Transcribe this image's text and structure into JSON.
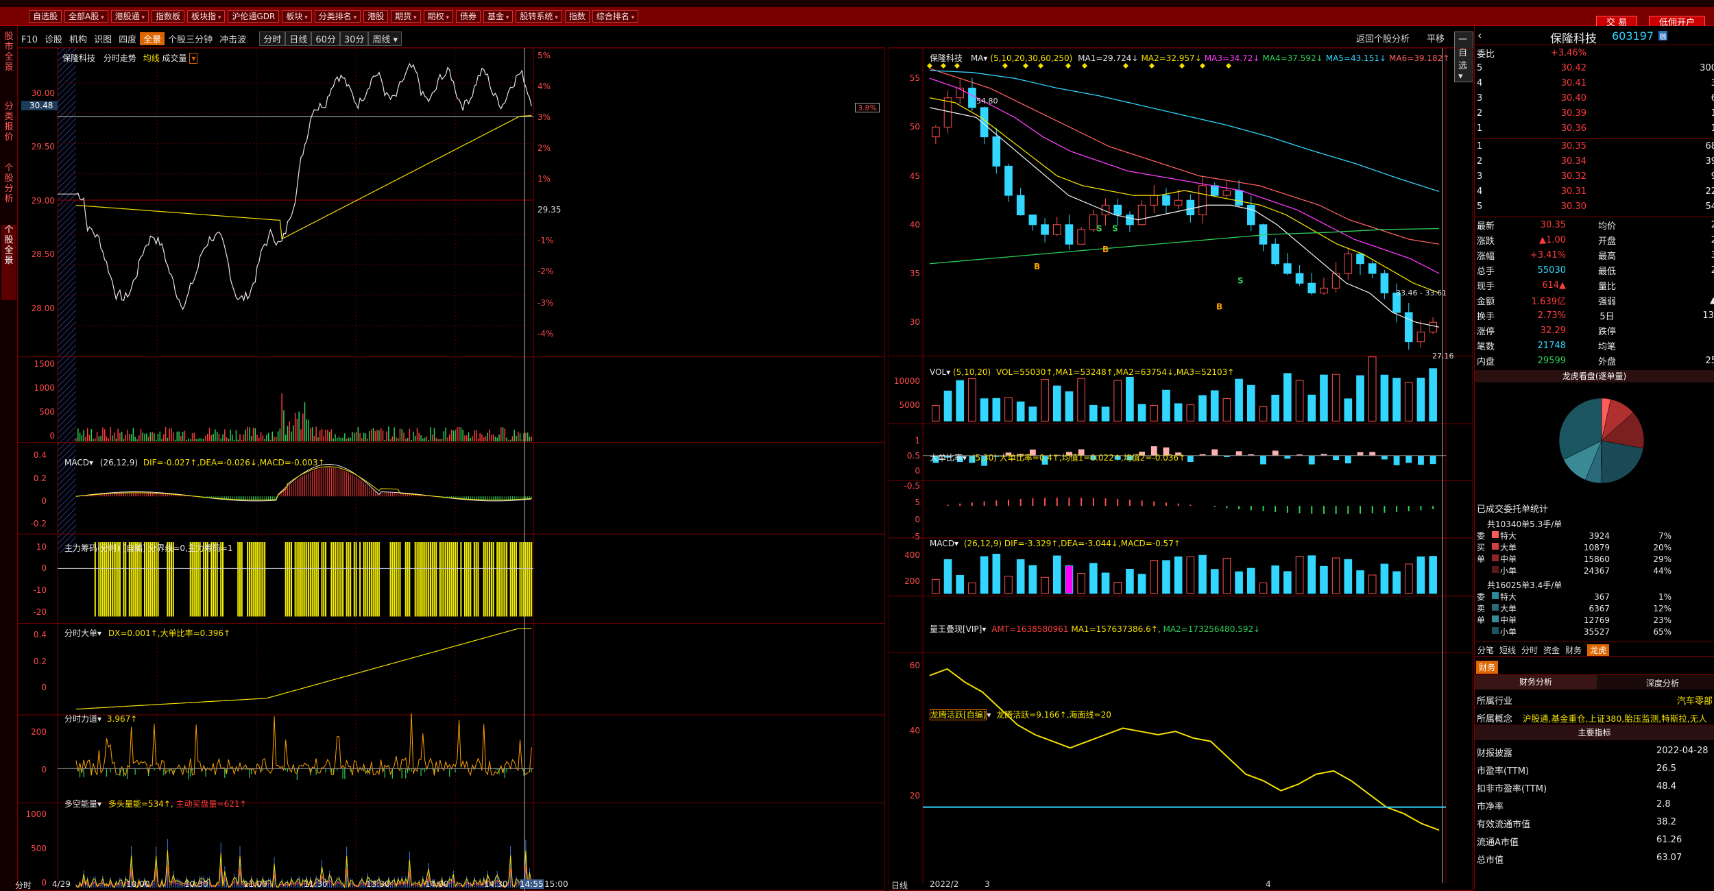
{
  "menu": {
    "items": [
      "自选股",
      "全部A股",
      "港股通",
      "指数板",
      "板块指",
      "沪伦通GDR",
      "板块",
      "分类排名",
      "港股",
      "期货",
      "期权",
      "债券",
      "基金",
      "股转系统",
      "指数",
      "综合排名"
    ],
    "trade_btn": "交 易",
    "account_btn": "低佣开户"
  },
  "left_tabs": [
    "股市全景",
    "分类报价",
    "个股分析",
    "个股全景"
  ],
  "toolbar": {
    "items": [
      "F10",
      "诊股",
      "机构",
      "识图",
      "四度",
      "全景",
      "个股三分钟",
      "冲击波"
    ],
    "periods": [
      "分时",
      "日线",
      "60分",
      "30分",
      "周线"
    ]
  },
  "right_toolbar": {
    "back": "返回个股分析",
    "flat": "平移",
    "mode": "一自选"
  },
  "intraday": {
    "header": {
      "name": "保隆科技",
      "mode": "分时走势",
      "avg": "均线",
      "vol": "成交量"
    },
    "price_label": "30.48",
    "y_left": [
      "30.00",
      "29.50",
      "29.00",
      "28.50",
      "28.00"
    ],
    "y_right": [
      "5%",
      "4%",
      "3%",
      "2%",
      "1%",
      "29.35",
      "-1%",
      "-2%",
      "-3%",
      "-4%"
    ],
    "pct_tag": "3.8%",
    "vol_axis": [
      "1500",
      "1000",
      "500",
      "0"
    ],
    "macd_title": "MACD",
    "macd_params": "(26,12,9)",
    "macd_vals": "DIF=-0.027↑,DEA=-0.026↓,MACD=-0.003↑",
    "macd_axis": [
      "0.4",
      "0.2",
      "0",
      "-0.2"
    ],
    "chip_title": "主力筹码(分时)",
    "chip_vals": "[自編] 分界线=0,主力筹码=1",
    "chip_axis": [
      "10",
      "0",
      "-10",
      "-20"
    ],
    "big_title": "分时大单",
    "big_vals": "DX=0.001↑,大单比率=0.396↑",
    "big_axis": [
      "0.4",
      "0.2",
      "0"
    ],
    "force_title": "分时力道",
    "force_vals": "3.967↑",
    "force_axis": [
      "200",
      "0"
    ],
    "energy_title": "多空能量",
    "energy_vals": "多头量能=534↑,",
    "energy_vals2": "主动买盘量=621↑",
    "energy_axis": [
      "1000",
      "500",
      "0"
    ],
    "time_axis": [
      "分时",
      "4/29",
      "10:00",
      "10:30",
      "11:00",
      "11:30",
      "13:30",
      "14:00",
      "14:30",
      "14:55",
      "15:00"
    ]
  },
  "kline": {
    "name": "保隆科技",
    "ma_label": "MA",
    "ma_params": "(5,10,20,30,60,250)",
    "ma_vals": [
      {
        "t": "MA1=29.724↓",
        "c": "#e8e8e8"
      },
      {
        "t": "MA2=32.957↓",
        "c": "#f5e000"
      },
      {
        "t": "MA3=34.72↓",
        "c": "#ff3cff"
      },
      {
        "t": "MA4=37.592↓",
        "c": "#2ed158"
      },
      {
        "t": "MA5=43.151↓",
        "c": "#33d6ff"
      },
      {
        "t": "MA6=39.182↑",
        "c": "#ff6060"
      }
    ],
    "y_axis": [
      "55",
      "50",
      "45",
      "40",
      "35",
      "30"
    ],
    "hi_label": "54.80",
    "lo_label": "27.16",
    "range_label": "33.46 - 33.61",
    "vol_title": "VOL",
    "vol_params": "(5,10,20)",
    "vol_vals": "VOL=55030↑,MA1=53248↑,MA2=63754↓,MA3=52103↑",
    "vol_axis": [
      "10000",
      "5000"
    ],
    "bigratio_title": "大单比率",
    "bigratio_vals": "(5,30) 大单比率=0.4↑,均值1=0.022↑,均值2=-0.036↑",
    "bigratio_axis": [
      "1",
      "0.5",
      "0",
      "-0.5"
    ],
    "macd_title": "MACD",
    "macd_vals": "(26,12,9) DIF=-3.329↑,DEA=-3.044↓,MACD=-0.57↑",
    "macd_axis": [
      "5",
      "0",
      "-5"
    ],
    "wang_title": "量王叠现[VIP]",
    "wang_vals": "AMT=1638580961",
    "wang_vals2": "MA1=157637386.6↑,",
    "wang_vals3": "MA2=173256480.592↓",
    "wang_axis": [
      "400",
      "200"
    ],
    "dragon_title": "龙腾活跃[自编]",
    "dragon_vals": "龙腾活跃=9.166↑,海面线=20",
    "dragon_axis": [
      "60",
      "40",
      "20"
    ],
    "time_axis": [
      "日线",
      "2022/2",
      "3",
      "4"
    ]
  },
  "quote": {
    "name": "保隆科技",
    "code": "603197",
    "weibi_label": "委比",
    "weibi": "+3.46%",
    "asks": [
      [
        "5",
        "30.42",
        "300"
      ],
      [
        "4",
        "30.41",
        "3"
      ],
      [
        "3",
        "30.40",
        "6"
      ],
      [
        "2",
        "30.39",
        "1"
      ],
      [
        "1",
        "30.36",
        "1"
      ]
    ],
    "bids": [
      [
        "1",
        "30.35",
        "68"
      ],
      [
        "2",
        "30.34",
        "39"
      ],
      [
        "3",
        "30.32",
        "9"
      ],
      [
        "4",
        "30.31",
        "22"
      ],
      [
        "5",
        "30.30",
        "54"
      ]
    ],
    "stats": [
      [
        "最新",
        "30.35",
        "均价",
        "2"
      ],
      [
        "涨跌",
        "▲1.00",
        "开盘",
        "2"
      ],
      [
        "涨幅",
        "+3.41%",
        "最高",
        "3"
      ],
      [
        "总手",
        "55030",
        "最低",
        "2"
      ],
      [
        "现手",
        "614▲",
        "量比",
        ""
      ],
      [
        "金额",
        "1.639亿",
        "强弱",
        "▲"
      ],
      [
        "换手",
        "2.73%",
        "5日",
        "13."
      ],
      [
        "涨停",
        "32.29",
        "跌停",
        ""
      ],
      [
        "笔数",
        "21748",
        "均笔",
        ""
      ],
      [
        "内盘",
        "29599",
        "外盘",
        "25"
      ]
    ],
    "dragon_title": "龙虎看盘(逐单量)",
    "deal_title": "已成交委托单统计",
    "buy_head": "共10340单5.3手/单",
    "buy_rows": [
      [
        "特大",
        "3924",
        "7%"
      ],
      [
        "大单",
        "10879",
        "20%"
      ],
      [
        "中单",
        "15860",
        "29%"
      ],
      [
        "小单",
        "24367",
        "44%"
      ]
    ],
    "sell_head": "共16025单3.4手/单",
    "sell_rows": [
      [
        "特大",
        "367",
        "1%"
      ],
      [
        "大单",
        "6367",
        "12%"
      ],
      [
        "中单",
        "12769",
        "23%"
      ],
      [
        "小单",
        "35527",
        "65%"
      ]
    ],
    "tabs": [
      "分笔",
      "短线",
      "分时",
      "资金",
      "财务",
      "龙虎"
    ],
    "fin_tab": "财务",
    "fin_sub": [
      "财务分析",
      "深度分析"
    ],
    "industry_label": "所属行业",
    "industry": "汽车零部",
    "concept_label": "所属概念",
    "concept": "沪股通,基金重仓,上证380,胎压监测,特斯拉,无人",
    "main_index": "主要指标",
    "fin_rows": [
      [
        "财报披露",
        "2022-04-28"
      ],
      [
        "市盈率(TTM)",
        "26.5"
      ],
      [
        "扣非市盈率(TTM)",
        "48.4"
      ],
      [
        "市净率",
        "2.8"
      ],
      [
        "有效流通市值",
        "38.2"
      ],
      [
        "流通A市值",
        "61.26"
      ],
      [
        "总市值",
        "63.07"
      ]
    ]
  }
}
